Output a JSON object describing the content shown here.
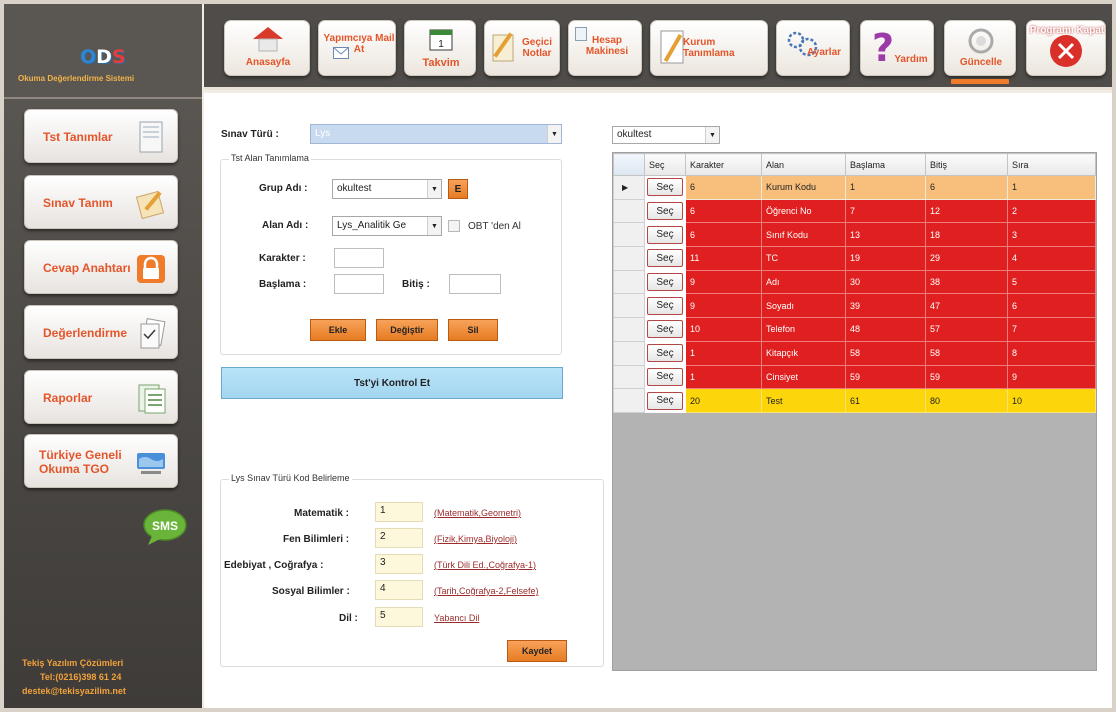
{
  "logo": {
    "name": "ODS",
    "subtitle": "Okuma Değerlendirme Sistemi"
  },
  "sidebar": {
    "items": [
      {
        "label": "Tst Tanımlar",
        "icon": "document-icon"
      },
      {
        "label": "Sınav Tanım",
        "icon": "notepad-icon"
      },
      {
        "label": "Cevap Anahtarı",
        "icon": "lock-icon"
      },
      {
        "label": "Değerlendirme",
        "icon": "papers-icon"
      },
      {
        "label": "Raporlar",
        "icon": "report-icon"
      },
      {
        "label": "Türkiye Geneli Okuma TGO",
        "icon": "map-icon"
      }
    ],
    "sms_label": "SMS",
    "contact": [
      "Tekiş Yazılım Çözümleri",
      "Tel:(0216)398 61 24",
      "destek@tekisyazilim.net"
    ]
  },
  "toolbar": {
    "items": [
      {
        "label": "Anasayfa",
        "icon": "home-icon"
      },
      {
        "label": "Yapımcıya Mail At",
        "icon": "mail-icon"
      },
      {
        "label": "Takvim",
        "icon": "calendar-icon"
      },
      {
        "label": "Geçici Notlar",
        "icon": "note-icon"
      },
      {
        "label": "Hesap Makinesi",
        "icon": "calculator-icon"
      },
      {
        "label": "Kurum Tanımlama",
        "icon": "edit-icon"
      },
      {
        "label": "Ayarlar",
        "icon": "gear-icon"
      },
      {
        "label": "Yardım",
        "icon": "help-icon"
      },
      {
        "label": "Güncelle",
        "icon": "update-icon",
        "active": true
      },
      {
        "label": "Programı Kapat",
        "icon": "close-icon"
      }
    ]
  },
  "form": {
    "exam_type_label": "Sınav Türü :",
    "exam_type_value": "Lys",
    "group_title": "Tst Alan Tanımlama",
    "group_name_label": "Grup Adı :",
    "group_name_value": "okultest",
    "group_e_button": "E",
    "field_name_label": "Alan Adı :",
    "field_name_value": "Lys_Analitik Ge",
    "obt_label": "OBT 'den Al",
    "char_label": "Karakter :",
    "char_value": "",
    "start_label": "Başlama :",
    "start_value": "",
    "end_label": "Bitiş :",
    "end_value": "",
    "add_button": "Ekle",
    "change_button": "Değiştir",
    "delete_button": "Sil",
    "check_button": "Tst'yi Kontrol Et"
  },
  "codes": {
    "title": "Lys Sınav Türü Kod Belirleme",
    "rows": [
      {
        "label": "Matematik :",
        "value": "1",
        "link": "(Matematik,Geometri)"
      },
      {
        "label": "Fen Bilimleri :",
        "value": "2",
        "link": "(Fizik,Kimya,Biyoloji)"
      },
      {
        "label": "Edebiyat , Coğrafya :",
        "value": "3",
        "link": "(Türk Dili  Ed.,Coğrafya-1)"
      },
      {
        "label": "Sosyal Bilimler :",
        "value": "4",
        "link": "(Tarih,Coğrafya-2,Felsefe)"
      },
      {
        "label": "Dil :",
        "value": "5",
        "link": "Yabancı Dil"
      }
    ],
    "save_button": "Kaydet"
  },
  "grid": {
    "filter_value": "okultest",
    "columns": [
      "Seç",
      "Karakter",
      "Alan",
      "Başlama",
      "Bitiş",
      "Sıra"
    ],
    "rows": [
      {
        "select": "Seç",
        "karakter": "6",
        "alan": "Kurum Kodu",
        "baslama": "1",
        "bitis": "6",
        "sira": "1",
        "style": "orange",
        "current": true
      },
      {
        "select": "Seç",
        "karakter": "6",
        "alan": "Öğrenci No",
        "baslama": "7",
        "bitis": "12",
        "sira": "2",
        "style": "red"
      },
      {
        "select": "Seç",
        "karakter": "6",
        "alan": "Sınıf Kodu",
        "baslama": "13",
        "bitis": "18",
        "sira": "3",
        "style": "red"
      },
      {
        "select": "Seç",
        "karakter": "11",
        "alan": "TC",
        "baslama": "19",
        "bitis": "29",
        "sira": "4",
        "style": "red"
      },
      {
        "select": "Seç",
        "karakter": "9",
        "alan": "Adı",
        "baslama": "30",
        "bitis": "38",
        "sira": "5",
        "style": "red"
      },
      {
        "select": "Seç",
        "karakter": "9",
        "alan": "Soyadı",
        "baslama": "39",
        "bitis": "47",
        "sira": "6",
        "style": "red"
      },
      {
        "select": "Seç",
        "karakter": "10",
        "alan": "Telefon",
        "baslama": "48",
        "bitis": "57",
        "sira": "7",
        "style": "red"
      },
      {
        "select": "Seç",
        "karakter": "1",
        "alan": "Kitapçık",
        "baslama": "58",
        "bitis": "58",
        "sira": "8",
        "style": "red"
      },
      {
        "select": "Seç",
        "karakter": "1",
        "alan": "Cinsiyet",
        "baslama": "59",
        "bitis": "59",
        "sira": "9",
        "style": "red"
      },
      {
        "select": "Seç",
        "karakter": "20",
        "alan": "Test",
        "baslama": "61",
        "bitis": "80",
        "sira": "10",
        "style": "yellow"
      }
    ]
  },
  "colors": {
    "accent": "#e4552a",
    "button_orange": "#e77c22",
    "row_red": "#e02020",
    "row_yellow": "#fcd60a",
    "row_orange": "#f7be7c",
    "check_button_blue": "#a8dcf4"
  }
}
